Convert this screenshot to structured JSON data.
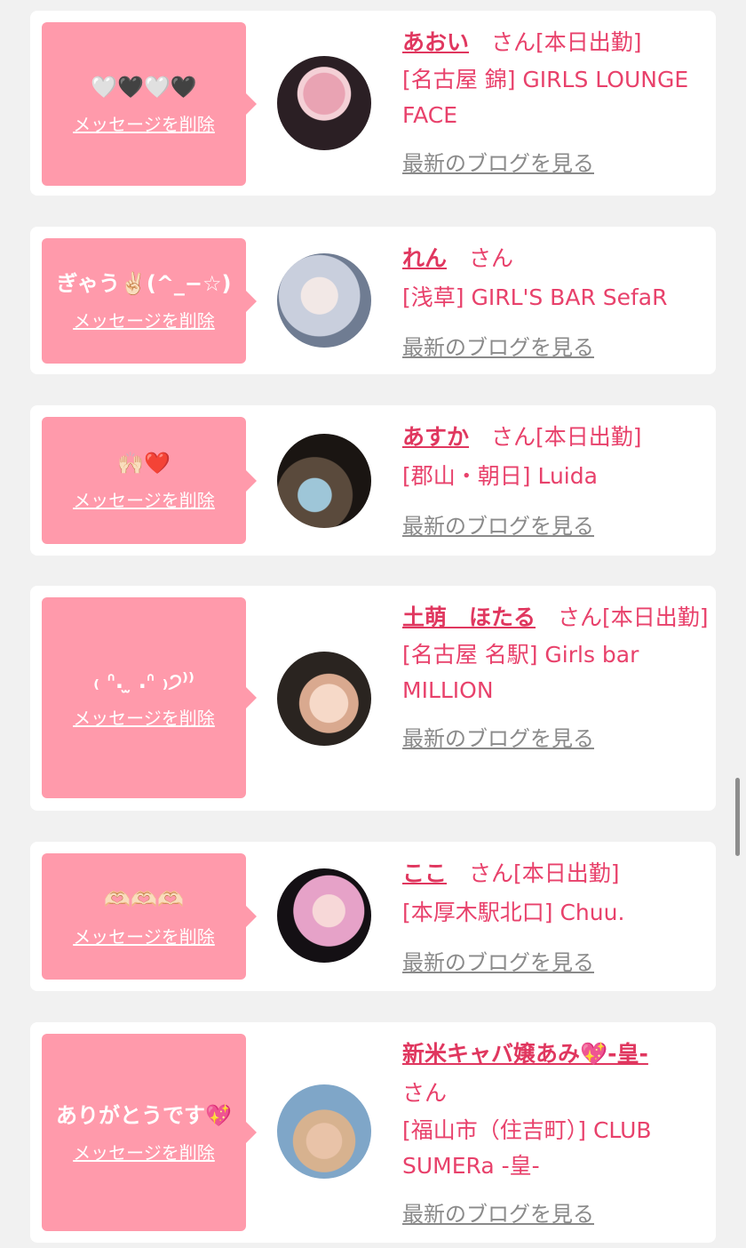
{
  "cards": [
    {
      "message": "🤍🖤🤍🖤",
      "delete_label": "メッセージを削除",
      "name": "あおい",
      "suffix": "　さん",
      "status": "[本日出勤]",
      "shop": "[名古屋 錦] GIRLS LOUNGE FACE",
      "blog_link": "最新のブログを見る",
      "avatar_colors": [
        "#2b1f24",
        "#e9a3b3",
        "#ffffff"
      ]
    },
    {
      "message": "ぎゃう✌🏻(^_−☆)",
      "delete_label": "メッセージを削除",
      "name": "れん",
      "suffix": "　さん",
      "status": "",
      "shop": "[浅草] GIRL'S BAR SefaR",
      "blog_link": "最新のブログを見る",
      "avatar_colors": [
        "#6f7c92",
        "#c9cfdd",
        "#f2e8e6"
      ]
    },
    {
      "message": "🙌🏻❤️",
      "delete_label": "メッセージを削除",
      "name": "あすか",
      "suffix": "　さん",
      "status": "[本日出勤]",
      "shop": "[郡山・朝日] Luida",
      "blog_link": "最新のブログを見る",
      "avatar_colors": [
        "#1a1512",
        "#5a4a3c",
        "#9ec6d8"
      ]
    },
    {
      "message": "₍ ᐢ. ̫ .ᐢ ₎੭⁾⁾",
      "delete_label": "メッセージを削除",
      "name": "土萌　ほたる",
      "suffix": "　さん",
      "status": "[本日出勤]",
      "shop": "[名古屋 名駅] Girls bar MILLION",
      "blog_link": "最新のブログを見る",
      "avatar_colors": [
        "#2a2420",
        "#d9a98f",
        "#f6d9c8"
      ]
    },
    {
      "message": "🫶🏻🫶🏻🫶🏻",
      "delete_label": "メッセージを削除",
      "name": "ここ",
      "suffix": "　さん",
      "status": "[本日出勤]",
      "shop": "[本厚木駅北口] Chuu.",
      "blog_link": "最新のブログを見る",
      "avatar_colors": [
        "#141014",
        "#e6a2c8",
        "#f7d8d8"
      ]
    },
    {
      "message": "ありがとうです💖",
      "delete_label": "メッセージを削除",
      "name": "新米キャバ嬢あみ💖-皇-",
      "suffix": "さん",
      "status": "",
      "shop": "[福山市（住吉町）] CLUB SUMERa -皇-",
      "blog_link": "最新のブログを見る",
      "avatar_colors": [
        "#7fa6c8",
        "#d7b28f",
        "#c9dcef"
      ]
    }
  ]
}
